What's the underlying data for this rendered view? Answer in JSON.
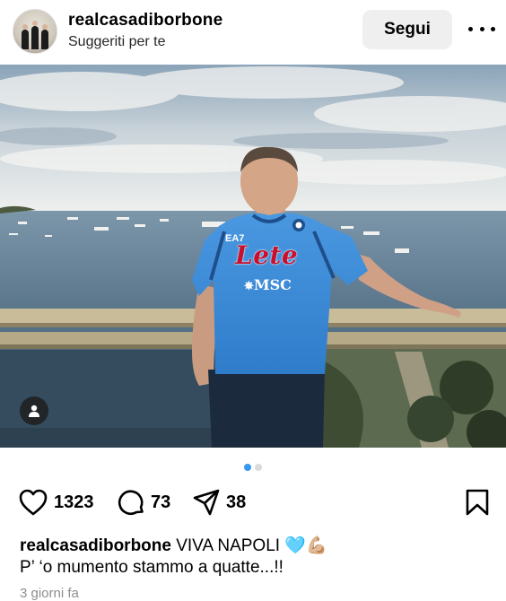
{
  "post": {
    "username": "realcasadiborbone",
    "subtitle": "Suggeriti per te",
    "follow_label": "Segui",
    "likes": "1323",
    "comments": "73",
    "shares": "38",
    "caption_username": "realcasadiborbone",
    "caption_text": " VIVA NAPOLI 🩵💪🏼",
    "caption_line2": "P’ ‘o mumento stammo a quatte...!!",
    "timestamp": "3 giorni fa"
  },
  "jersey": {
    "brand": "EA7",
    "sponsor": "Lete",
    "sponsor2": "MSC"
  },
  "carousel": {
    "total": 2,
    "active": 1
  },
  "colors": {
    "dot_active": "#3897f0",
    "dot_inactive": "#dbdbdb",
    "button_bg": "#efefef",
    "jersey_blue": "#3d8ed8",
    "lete_red": "#c8102e"
  },
  "icons": [
    "heart-icon",
    "comment-icon",
    "share-icon",
    "bookmark-icon",
    "more-icon",
    "user-tag-icon"
  ]
}
